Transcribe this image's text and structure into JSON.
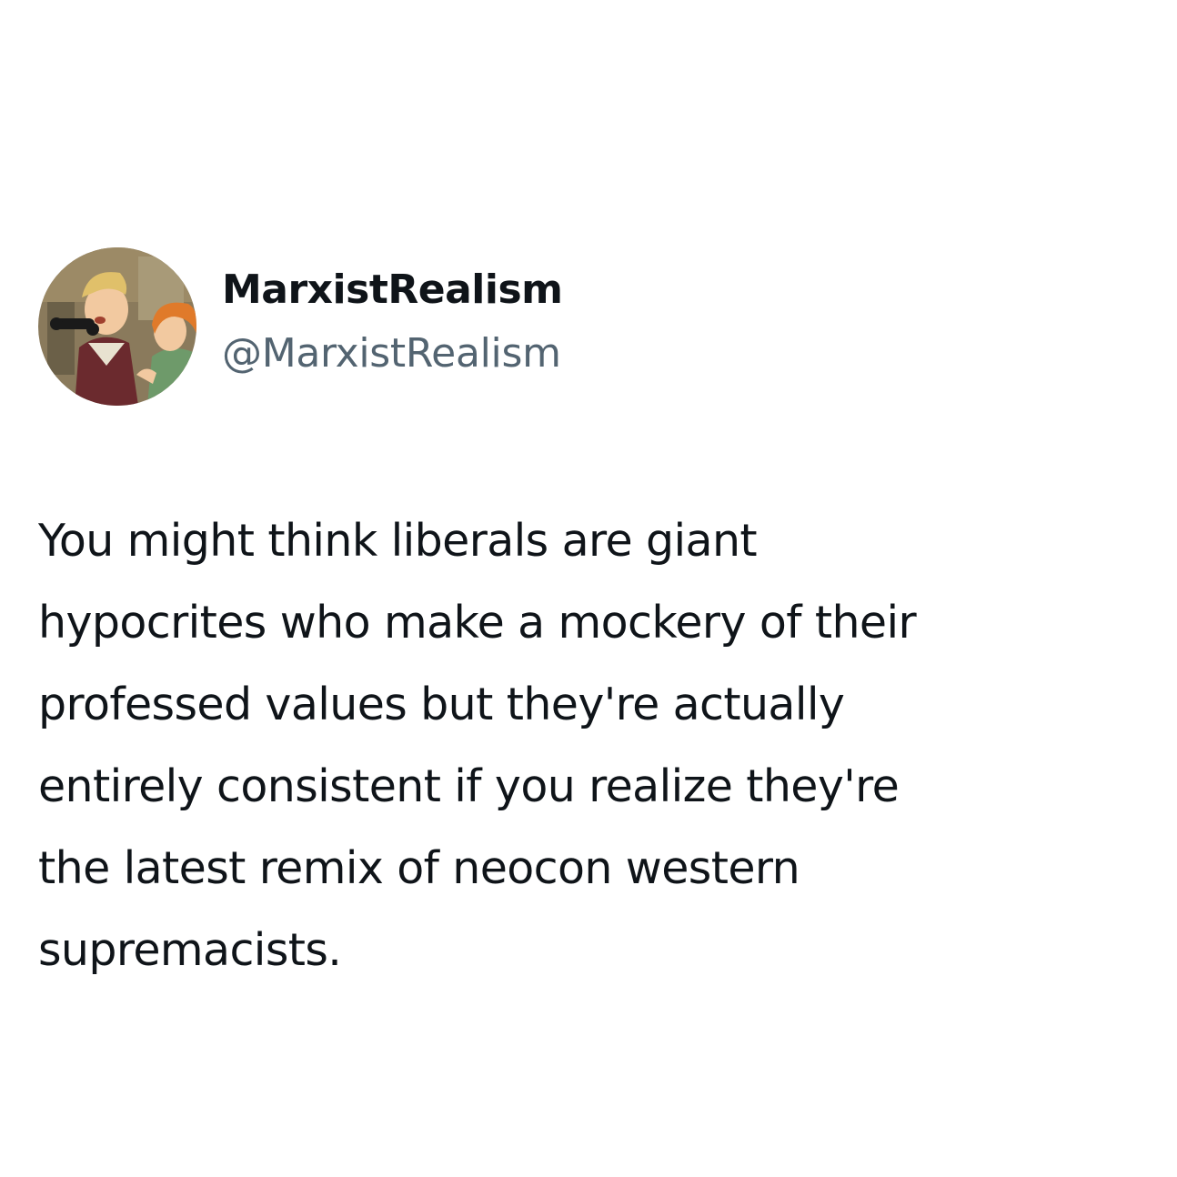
{
  "author": {
    "display_name": "MarxistRealism",
    "handle": "@MarxistRealism",
    "avatar_icon": "cartoon-characters-avatar"
  },
  "tweet": {
    "lines": [
      "You might think liberals are giant",
      "hypocrites who make a mockery of their",
      "professed values but they're actually",
      "entirely consistent if you realize they're",
      "the latest remix of neocon western",
      "supremacists."
    ]
  },
  "colors": {
    "background": "#ffffff",
    "text_primary": "#0f1419",
    "text_secondary": "#536471"
  }
}
